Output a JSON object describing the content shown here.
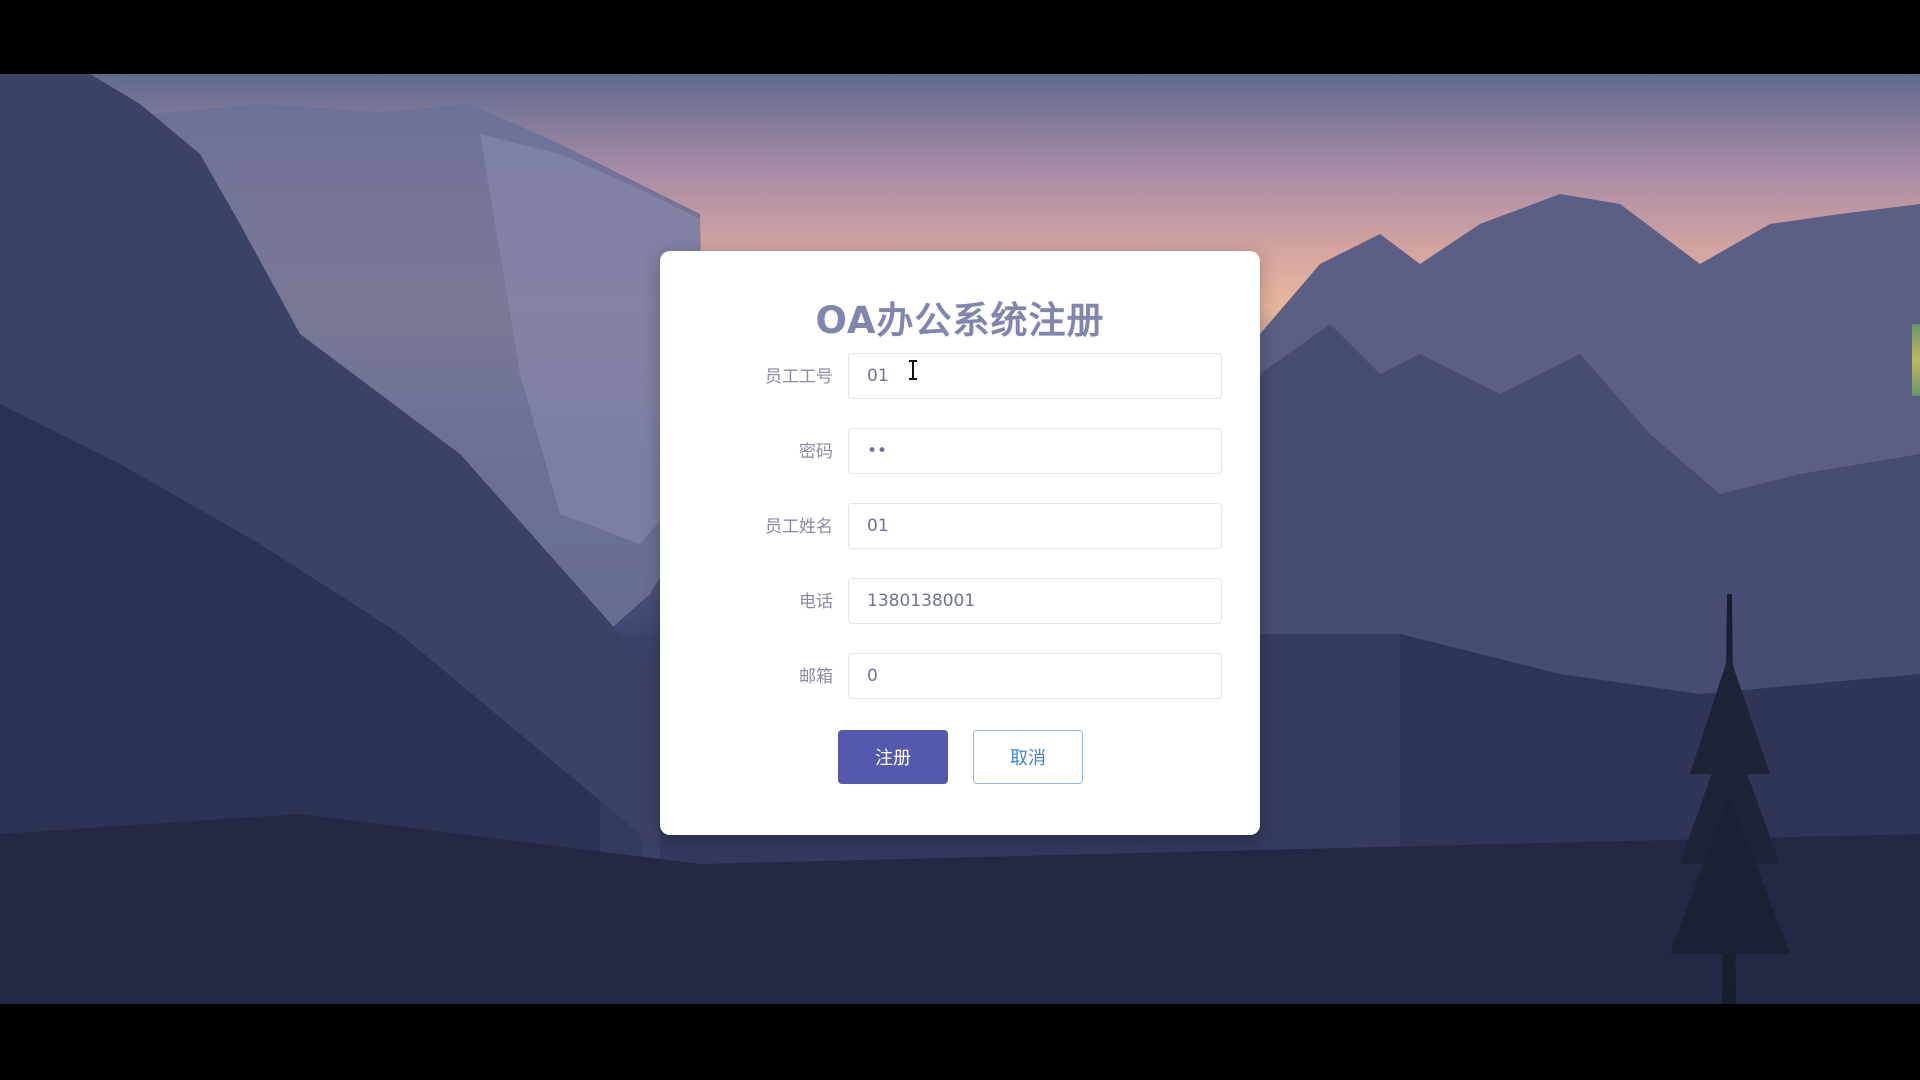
{
  "dialog": {
    "title": "OA办公系统注册"
  },
  "form": {
    "fields": [
      {
        "label": "员工工号",
        "value": "01"
      },
      {
        "label": "密码",
        "value": "••"
      },
      {
        "label": "员工姓名",
        "value": "01"
      },
      {
        "label": "电话",
        "value": "1380138001"
      },
      {
        "label": "邮箱",
        "value": "0"
      }
    ],
    "register_label": "注册",
    "cancel_label": "取消"
  },
  "colors": {
    "title": "#8186b0",
    "primary_button": "#5459ad",
    "secondary_button_text": "#3e84d6"
  },
  "icons": {
    "cursor": "text-cursor-icon"
  }
}
